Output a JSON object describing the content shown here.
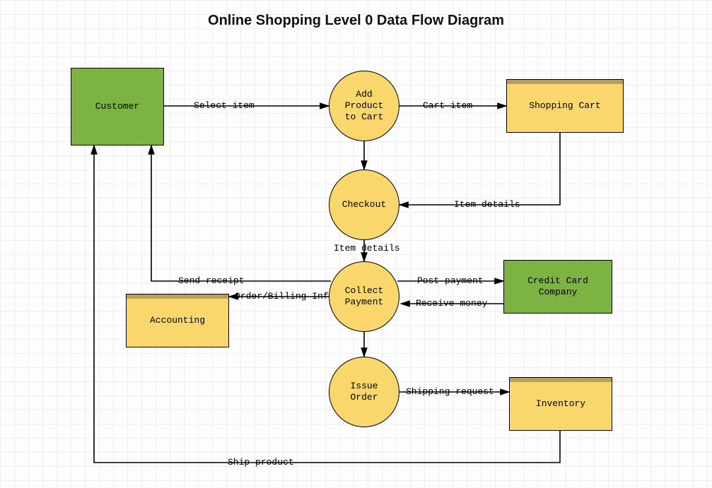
{
  "diagram": {
    "title": "Online Shopping Level 0 Data Flow Diagram",
    "type": "data-flow-diagram-level-0",
    "colors": {
      "external_green": "#7cb342",
      "process_yellow": "#f9d76c",
      "store_yellow": "#f9d76c"
    },
    "nodes": {
      "customer": {
        "label": "Customer",
        "kind": "external-entity",
        "color": "green"
      },
      "add_to_cart": {
        "label": "Add\nProduct\nto Cart",
        "kind": "process",
        "color": "yellow"
      },
      "shopping_cart": {
        "label": "Shopping Cart",
        "kind": "data-store",
        "color": "yellow"
      },
      "checkout": {
        "label": "Checkout",
        "kind": "process",
        "color": "yellow"
      },
      "collect_payment": {
        "label": "Collect\nPayment",
        "kind": "process",
        "color": "yellow"
      },
      "credit_card": {
        "label": "Credit Card\nCompany",
        "kind": "external-entity",
        "color": "green"
      },
      "accounting": {
        "label": "Accounting",
        "kind": "data-store",
        "color": "yellow"
      },
      "issue_order": {
        "label": "Issue\nOrder",
        "kind": "process",
        "color": "yellow"
      },
      "inventory": {
        "label": "Inventory",
        "kind": "data-store",
        "color": "yellow"
      }
    },
    "flows": {
      "select_item": {
        "label": "Select item",
        "from": "customer",
        "to": "add_to_cart"
      },
      "cart_item": {
        "label": "Cart item",
        "from": "add_to_cart",
        "to": "shopping_cart"
      },
      "item_details_cart": {
        "label": "Item details",
        "from": "shopping_cart",
        "to": "checkout"
      },
      "item_details_chk": {
        "label": "Item details",
        "from": "checkout",
        "to": "collect_payment"
      },
      "send_receipt": {
        "label": "Send receipt",
        "from": "collect_payment",
        "to": "customer"
      },
      "order_billing": {
        "label": "Order/Billing Info",
        "from": "collect_payment",
        "to": "accounting"
      },
      "post_payment": {
        "label": "Post payment",
        "from": "collect_payment",
        "to": "credit_card"
      },
      "receive_money": {
        "label": "Receive money",
        "from": "credit_card",
        "to": "collect_payment"
      },
      "shipping_request": {
        "label": "Shipping request",
        "from": "issue_order",
        "to": "inventory"
      },
      "ship_product": {
        "label": "Ship product",
        "from": "inventory",
        "to": "customer"
      }
    }
  }
}
